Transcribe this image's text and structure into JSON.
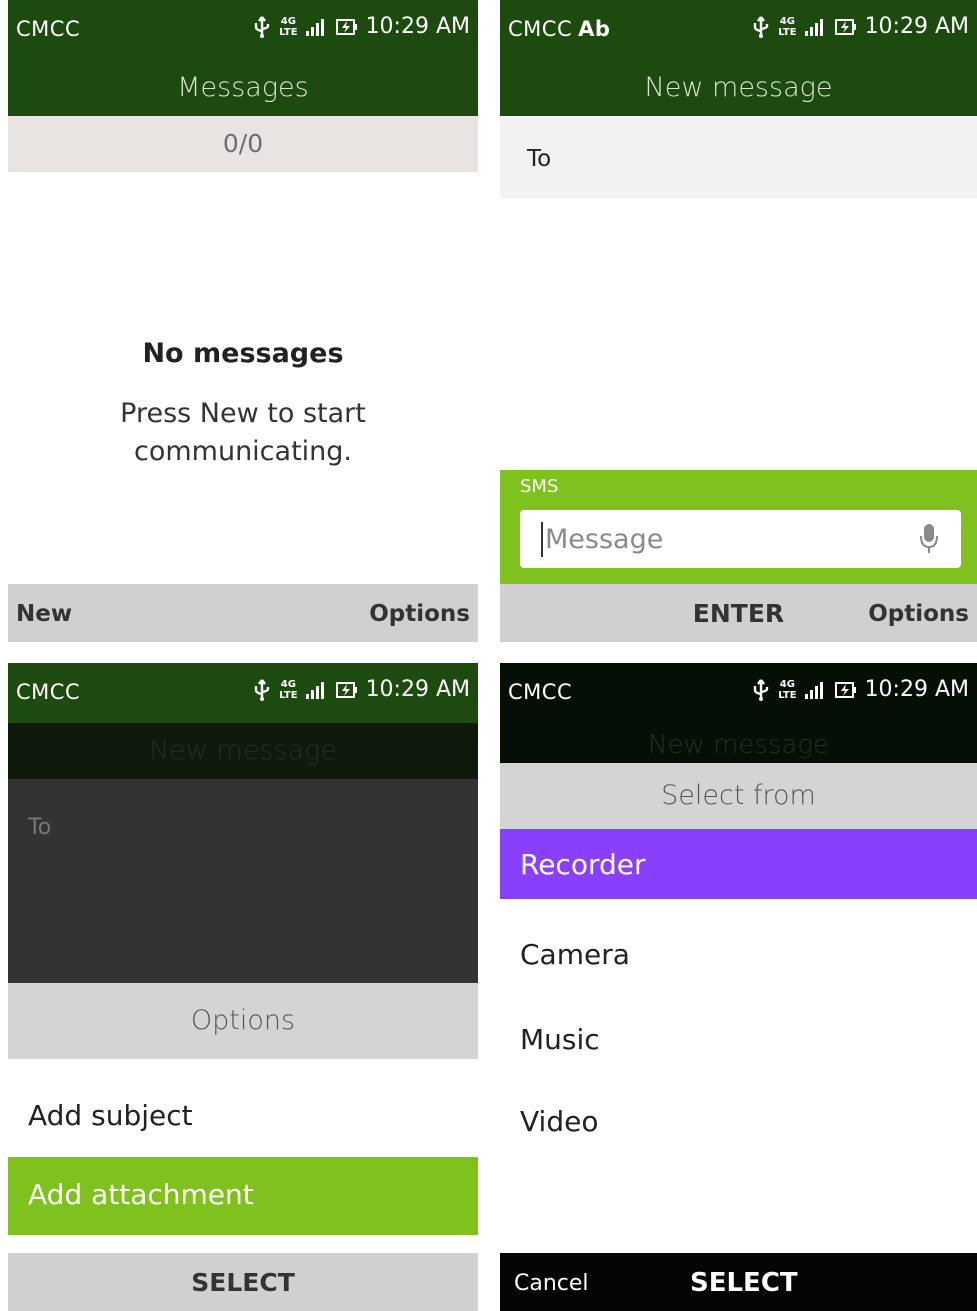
{
  "status": {
    "carrier": "CMCC",
    "carrier_extra": "Ab",
    "network": [
      "4G",
      "LTE"
    ],
    "time": "10:29 AM"
  },
  "screen1": {
    "title": "Messages",
    "counter": "0/0",
    "empty_title": "No messages",
    "empty_desc": "Press New to start communicating.",
    "softkeys": {
      "left": "New",
      "right": "Options"
    }
  },
  "screen2": {
    "title": "New message",
    "to_label": "To",
    "mode": "SMS",
    "message_placeholder": "Message",
    "softkeys": {
      "center": "ENTER",
      "right": "Options"
    }
  },
  "screen3": {
    "title": "New message",
    "to_label": "To",
    "options_header": "Options",
    "items": [
      "Add subject",
      "Add attachment"
    ],
    "selected_index": 1,
    "softkeys": {
      "center": "SELECT"
    }
  },
  "screen4": {
    "title": "New message",
    "header": "Select from",
    "items": [
      "Recorder",
      "Camera",
      "Music",
      "Video"
    ],
    "selected_index": 0,
    "softkeys": {
      "left": "Cancel",
      "center": "SELECT"
    }
  },
  "colors": {
    "status_green": "#1d4a0e",
    "accent_green": "#7fc21d",
    "accent_purple": "#8a3ffc",
    "softkey_gray": "#d0d0d0"
  }
}
